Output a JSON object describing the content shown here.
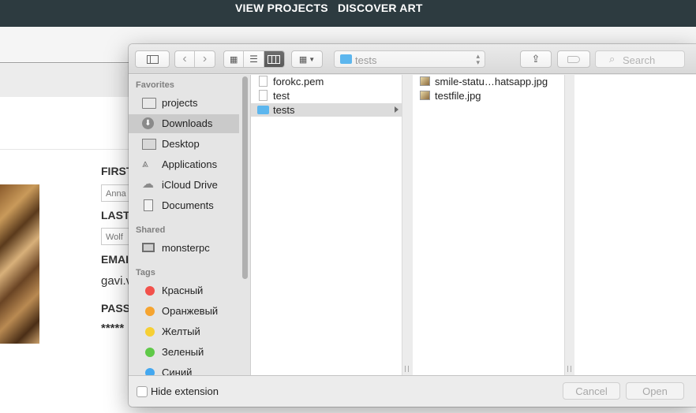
{
  "webpage": {
    "nav": [
      "VIEW PROJECTS",
      "DISCOVER ART"
    ],
    "form": {
      "first_label": "FIRST",
      "first_value": "Anna",
      "last_label": "LAST",
      "last_value": "Wolf",
      "email_label": "EMAI",
      "email_value": "gavi.v",
      "password_label": "PASS",
      "password_value": "*****"
    }
  },
  "dialog": {
    "toolbar": {
      "path_label": "tests",
      "search_placeholder": "Search"
    },
    "sidebar": {
      "favorites_heading": "Favorites",
      "favorites": [
        {
          "label": "projects",
          "icon": "folder-icon"
        },
        {
          "label": "Downloads",
          "icon": "downloads-icon",
          "selected": true
        },
        {
          "label": "Desktop",
          "icon": "desktop-icon"
        },
        {
          "label": "Applications",
          "icon": "applications-icon"
        },
        {
          "label": "iCloud Drive",
          "icon": "cloud-icon"
        },
        {
          "label": "Documents",
          "icon": "documents-icon"
        }
      ],
      "shared_heading": "Shared",
      "shared": [
        {
          "label": "monsterpc",
          "icon": "computer-icon"
        }
      ],
      "tags_heading": "Tags",
      "tags": [
        {
          "label": "Красный",
          "color": "#f2514b"
        },
        {
          "label": "Оранжевый",
          "color": "#f5a430"
        },
        {
          "label": "Желтый",
          "color": "#f6cf34"
        },
        {
          "label": "Зеленый",
          "color": "#5fc948"
        },
        {
          "label": "Синий",
          "color": "#44a8f0"
        }
      ]
    },
    "column1": [
      {
        "name": "forokc.pem",
        "type": "file"
      },
      {
        "name": "test",
        "type": "file"
      },
      {
        "name": "tests",
        "type": "folder",
        "selected": true
      }
    ],
    "column2": [
      {
        "name": "smile-statu…hatsapp.jpg",
        "type": "image"
      },
      {
        "name": "testfile.jpg",
        "type": "image"
      }
    ],
    "bottom": {
      "hide_extension_label": "Hide extension",
      "hide_extension_checked": false,
      "cancel_label": "Cancel",
      "open_label": "Open"
    }
  }
}
